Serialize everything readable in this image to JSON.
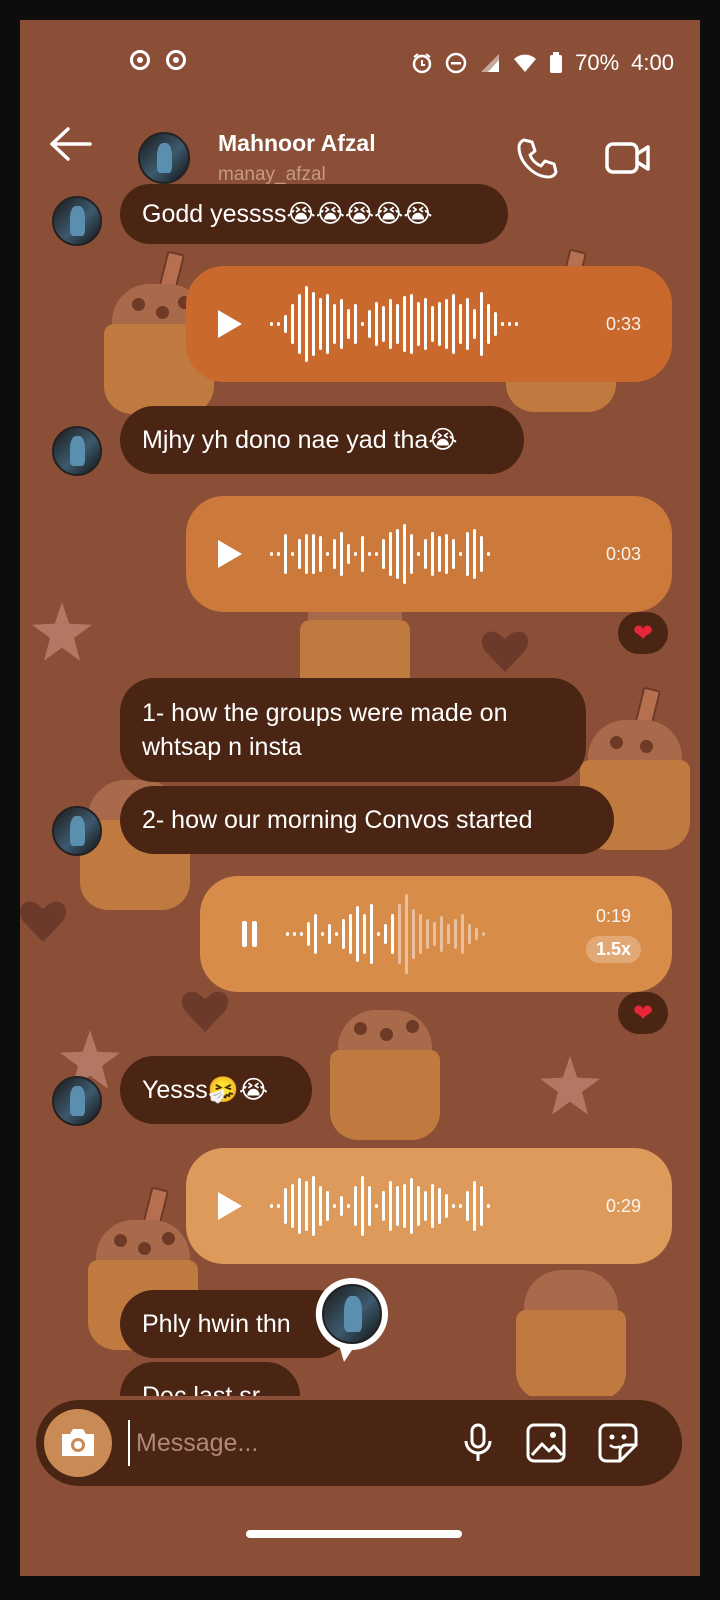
{
  "status_bar": {
    "battery": "70%",
    "time": "4:00"
  },
  "header": {
    "contact_name": "Mahnoor Afzal",
    "contact_handle": "manay_afzal"
  },
  "messages": {
    "m1": "Godd yessss😭😭😭😭😭",
    "v1_duration": "0:33",
    "m2": "Mjhy yh dono nae yad tha😭",
    "v2_duration": "0:03",
    "m3": "1- how the groups were made on whtsap n insta",
    "m4": "2- how our morning Convos started",
    "v3_duration": "0:19",
    "v3_speed": "1.5x",
    "m5": "Yesss🤧😭",
    "v4_duration": "0:29",
    "m6": "Phly hwin thn",
    "m7": "Dec last sr"
  },
  "reactions": {
    "r1": "❤",
    "r2": "❤"
  },
  "voice_messages": [
    {
      "color": "#c9692e",
      "state": "paused"
    },
    {
      "color": "#cc7a3c",
      "state": "paused"
    },
    {
      "color": "#d88c4a",
      "state": "playing",
      "progress": 0.5
    },
    {
      "color": "#dd9a5a",
      "state": "paused"
    }
  ],
  "composer": {
    "placeholder": "Message..."
  },
  "colors": {
    "background": "#8a4f36",
    "incoming_bubble": "#4a2513",
    "reaction": "#e8263a"
  }
}
